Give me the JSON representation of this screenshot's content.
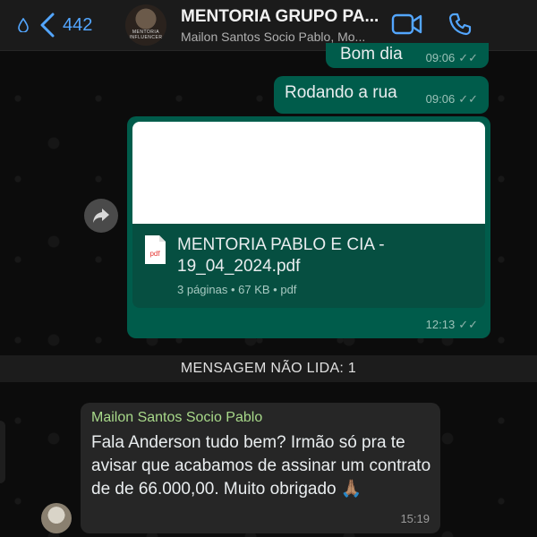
{
  "header": {
    "unread_count": "442",
    "title": "MENTORIA GRUPO PA...",
    "subtitle": "Mailon Santos Socio Pablo, Mo...",
    "avatar_text": "MENTORIA INFLUENCER",
    "accent_color": "#53a6ff",
    "icons": [
      "drop-icon",
      "back-icon",
      "video-call-icon",
      "phone-icon"
    ]
  },
  "messages": [
    {
      "text": "Bom dia",
      "time": "09:06",
      "status": "read"
    },
    {
      "text": "Rodando a rua",
      "time": "09:06",
      "status": "read"
    },
    {
      "type": "document",
      "file_name": "MENTORIA PABLO E CIA - 19_04_2024.pdf",
      "file_meta": "3 páginas • 67 KB • pdf",
      "pdf_label": "pdf",
      "time": "12:13",
      "status": "read"
    }
  ],
  "unread_divider": "MENSAGEM NÃO LIDA: 1",
  "incoming": {
    "sender": "Mailon Santos Socio Pablo",
    "text": "Fala Anderson tudo bem? Irmão só pra te avisar que acabamos de  assinar um contrato de de 66.000,00. Muito obrigado 🙏🏽",
    "time": "15:19"
  }
}
